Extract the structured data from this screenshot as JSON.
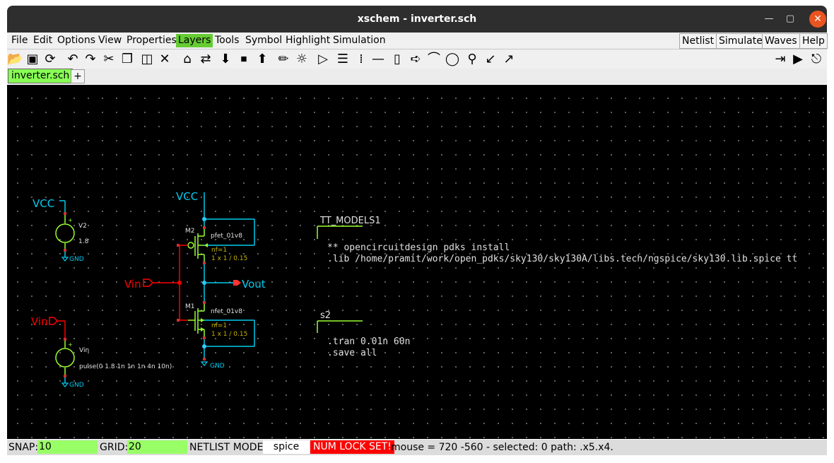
{
  "window": {
    "title": "xschem - inverter.sch"
  },
  "menubar": {
    "items": [
      "File",
      "Edit",
      "Options",
      "View",
      "Properties",
      "Layers",
      "Tools",
      "Symbol",
      "Highlight",
      "Simulation"
    ],
    "right_buttons": [
      "Netlist",
      "Simulate",
      "Waves",
      "Help"
    ]
  },
  "tabs": {
    "active": "inverter.sch",
    "add": "+"
  },
  "schematic": {
    "vcc_left": "VCC",
    "v2_name": "V2",
    "v2_value": "1.8",
    "gnd1": "GND",
    "vcc_top": "VCC",
    "m2_name": "M2",
    "m2_model": "pfet_01v8",
    "m2_nf": "nf=1",
    "m2_size": "1 x 1 / 0.15",
    "vin_gate": "Vin",
    "vout": "Vout",
    "m1_name": "M1",
    "m1_model": "nfet_01v8",
    "m1_nf": "nf=1",
    "m1_size": "1 x 1 / 0.15",
    "gnd_m1": "GND",
    "vin_src": "Vin",
    "vsrc_name": "Vin",
    "vsrc_value": "pulse(0 1.8 1n 1n 1n 4n 10n)",
    "gnd2": "GND",
    "code1_name": "TT_MODELS1",
    "code1_line1": "** opencircuitdesign pdks install",
    "code1_line2": ".lib /home/pramit/work/open_pdks/sky130/sky130A/libs.tech/ngspice/sky130.lib.spice tt",
    "code2_name": "s2",
    "code2_line1": ".tran 0.01n 60n",
    "code2_line2": ".save all"
  },
  "status": {
    "snap_label": "SNAP:",
    "snap_value": "10",
    "grid_label": "GRID:",
    "grid_value": "20",
    "netlist_label": "NETLIST MODE:",
    "netlist_value": "spice",
    "numlock": "NUM LOCK SET!",
    "info": "mouse = 720 -560 - selected: 0 path: .x5.x4."
  },
  "colors": {
    "net_red": "#ff0000",
    "wire_cyan": "#00ccee",
    "symbol_green": "#99ff33",
    "pin_red": "#cc3333",
    "dot_cyan": "#33ccff",
    "attr_yellow": "#c8b400",
    "text_gray": "#e0e0e0",
    "menu_active": "#66cc33"
  }
}
